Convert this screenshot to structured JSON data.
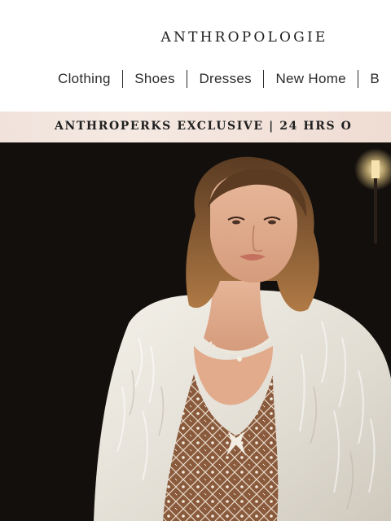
{
  "header": {
    "logo": "ANTHROPOLOGIE"
  },
  "nav": {
    "items": [
      {
        "label": "Clothing"
      },
      {
        "label": "Shoes"
      },
      {
        "label": "Dresses"
      },
      {
        "label": "New Home"
      },
      {
        "label": "B"
      }
    ]
  },
  "promo": {
    "text": "ANTHROPERKS EXCLUSIVE  |  24 HRS O"
  },
  "hero": {
    "image_description": "model-in-white-faux-fur-coat"
  }
}
